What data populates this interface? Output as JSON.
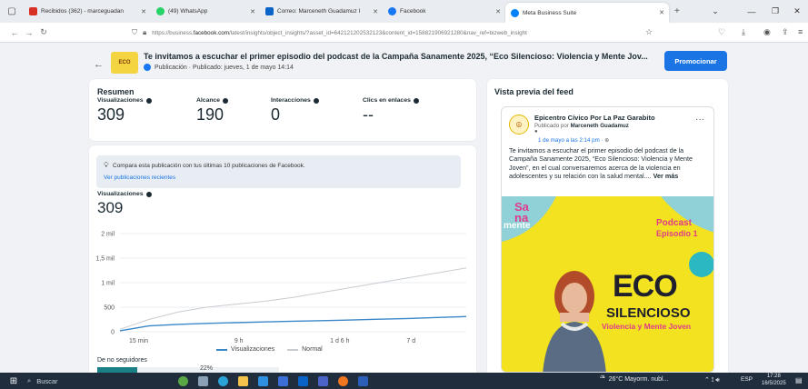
{
  "browser": {
    "tabs": [
      {
        "label": "Recibidos (362) - marceguadan",
        "color": "#d93025",
        "active": false
      },
      {
        "label": "(49) WhatsApp",
        "color": "#25d366",
        "active": false
      },
      {
        "label": "Correo: Marceneth Guadamuz I",
        "color": "#0a64c8",
        "active": false
      },
      {
        "label": "Facebook",
        "color": "#1877f2",
        "active": false
      },
      {
        "label": "Meta Business Suite",
        "color": "#0081fb",
        "active": true
      }
    ],
    "url_prefix": "https://business.",
    "url_domain": "facebook.com",
    "url_rest": "/latest/insights/object_insights/?asset_id=642121202532123&content_id=158821906921280&nav_ref=bizweb_insight"
  },
  "header": {
    "avatar_text": "ECO",
    "title": "Te invitamos a escuchar el primer episodio del podcast de la Campaña Sanamente 2025, “Eco Silencioso: Violencia y Mente Jov...",
    "subtitle": "Publicación · Publicado: jueves, 1 de mayo 14:14",
    "promote_label": "Promocionar"
  },
  "summary": {
    "title": "Resumen",
    "metrics": [
      {
        "label": "Visualizaciones",
        "value": "309"
      },
      {
        "label": "Alcance",
        "value": "190"
      },
      {
        "label": "Interacciones",
        "value": "0"
      },
      {
        "label": "Clics en enlaces",
        "value": "--"
      }
    ]
  },
  "compare": {
    "text": "Compara esta publicación con tus últimas 10 publicaciones de Facebook.",
    "link": "Ver publicaciones recientes"
  },
  "views": {
    "label": "Visualizaciones",
    "value": "309"
  },
  "chart_data": {
    "type": "line",
    "x_tick_labels": [
      "15 min",
      "9 h",
      "1 d 6 h",
      "7 d"
    ],
    "y_tick_labels": [
      "0",
      "500",
      "1 mil",
      "1,5 mil",
      "2 mil"
    ],
    "ylim": [
      0,
      2000
    ],
    "x": [
      0,
      1,
      2,
      3,
      4,
      5,
      6,
      7,
      8,
      9,
      10,
      11,
      12
    ],
    "series": [
      {
        "name": "Visualizaciones",
        "color": "#3a87c8",
        "values": [
          20,
          120,
          150,
          170,
          185,
          200,
          215,
          225,
          240,
          255,
          270,
          290,
          309
        ]
      },
      {
        "name": "Normal",
        "color": "#c8ccd1",
        "values": [
          50,
          250,
          400,
          500,
          560,
          620,
          700,
          800,
          900,
          1000,
          1100,
          1200,
          1300
        ]
      }
    ],
    "grid": true
  },
  "segments": {
    "label": "De no seguidores",
    "percent": "22%",
    "fraction": 0.22
  },
  "feed": {
    "title": "Vista previa del feed",
    "page_name": "Epicentro Cívico Por La Paz Garabito",
    "published_by_prefix": "Publicado por ",
    "published_by": "Marceneth Guadamuz",
    "date": "1 de mayo a las 2:14 pm · ",
    "text": "Te invitamos a escuchar el primer episodio del podcast de la Campaña Sanamente 2025, “Eco Silencioso: Violencia y Mente Joven”, en el cual conversaremos acerca de la violencia en adolescentes y su relación con la salud mental.... ",
    "more": "Ver más",
    "poster": {
      "logo_top": "Sa",
      "logo_mid": "na",
      "logo_bottom": "mente",
      "podcast": "Podcast",
      "episode": "Episodio 1",
      "eco": "ECO",
      "silencioso": "SILENCIOSO",
      "tagline": "Violencia y Mente Joven"
    }
  },
  "taskbar": {
    "search": "Buscar",
    "weather": "26°C Mayorm. nubl...",
    "lang": "ESP",
    "time": "17:28",
    "date": "16/5/2025"
  }
}
